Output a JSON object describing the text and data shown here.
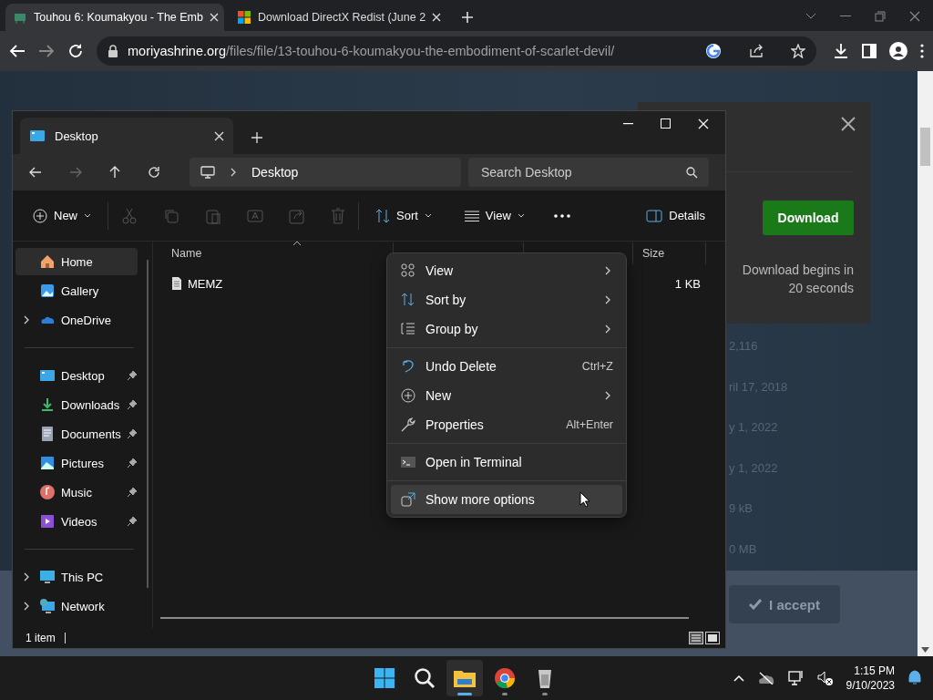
{
  "browser": {
    "tabs": [
      {
        "title": "Touhou 6: Koumakyou - The Emb",
        "selected": true
      },
      {
        "title": "Download DirectX Redist (June 2",
        "selected": false
      }
    ],
    "url_host": "moriyashrine.org",
    "url_path": "/files/file/13-touhou-6-koumakyou-the-embodiment-of-scarlet-devil/"
  },
  "webpage": {
    "modal": {
      "button": "Download",
      "note_lines": [
        "Download begins in",
        "20 seconds"
      ]
    },
    "fragments": [
      "2,116",
      "ril 17, 2018",
      "y 1, 2022",
      "y 1, 2022",
      "9 kB",
      "0 MB"
    ],
    "accept_button": "I accept"
  },
  "explorer": {
    "tab": "Desktop",
    "breadcrumb": "Desktop",
    "search": {
      "placeholder": "Search Desktop"
    },
    "toolbar": {
      "new": "New",
      "sort": "Sort",
      "view": "View",
      "details": "Details"
    },
    "sidebar": {
      "groups": [
        [
          {
            "label": "Home",
            "selected": true,
            "expandable": false,
            "pinned": false
          },
          {
            "label": "Gallery",
            "selected": false,
            "expandable": false,
            "pinned": false
          },
          {
            "label": "OneDrive",
            "selected": false,
            "expandable": true,
            "pinned": false
          }
        ],
        [
          {
            "label": "Desktop",
            "selected": false,
            "expandable": false,
            "pinned": true
          },
          {
            "label": "Downloads",
            "selected": false,
            "expandable": false,
            "pinned": true
          },
          {
            "label": "Documents",
            "selected": false,
            "expandable": false,
            "pinned": true
          },
          {
            "label": "Pictures",
            "selected": false,
            "expandable": false,
            "pinned": true
          },
          {
            "label": "Music",
            "selected": false,
            "expandable": false,
            "pinned": true
          },
          {
            "label": "Videos",
            "selected": false,
            "expandable": false,
            "pinned": true
          }
        ],
        [
          {
            "label": "This PC",
            "selected": false,
            "expandable": true,
            "pinned": false
          },
          {
            "label": "Network",
            "selected": false,
            "expandable": true,
            "pinned": false
          }
        ]
      ]
    },
    "columns": [
      "Name",
      "Size"
    ],
    "files": [
      {
        "name": "MEMZ",
        "size": "1 KB"
      }
    ],
    "status": "1 item",
    "context_menu": [
      [
        {
          "label": "View",
          "submenu": true,
          "hovered": false
        },
        {
          "label": "Sort by",
          "submenu": true,
          "hovered": false
        },
        {
          "label": "Group by",
          "submenu": true,
          "hovered": false
        }
      ],
      [
        {
          "label": "Undo Delete",
          "shortcut": "Ctrl+Z",
          "submenu": false,
          "hovered": false
        },
        {
          "label": "New",
          "submenu": true,
          "hovered": false
        },
        {
          "label": "Properties",
          "shortcut": "Alt+Enter",
          "submenu": false,
          "hovered": false
        }
      ],
      [
        {
          "label": "Open in Terminal",
          "submenu": false,
          "hovered": false
        }
      ],
      [
        {
          "label": "Show more options",
          "submenu": false,
          "hovered": true
        }
      ]
    ]
  },
  "taskbar": {
    "apps": [
      {
        "active": false,
        "running": false
      },
      {
        "active": false,
        "running": false
      },
      {
        "active": true,
        "running": true
      },
      {
        "active": false,
        "running": true
      },
      {
        "active": false,
        "running": true
      }
    ],
    "time": "1:15 PM",
    "date": "9/10/2023"
  }
}
